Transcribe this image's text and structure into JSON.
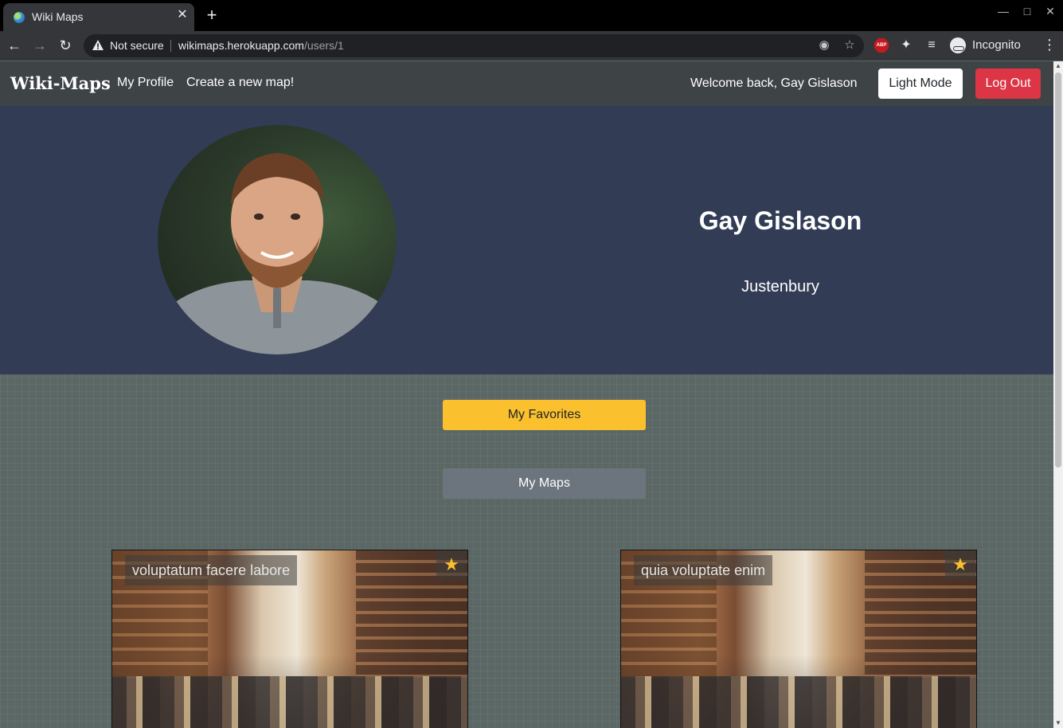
{
  "browser": {
    "tab_title": "Wiki Maps",
    "tab_close": "✕",
    "new_tab": "+",
    "security_label": "Not secure",
    "url_host": "wikimaps.herokuapp.com",
    "url_path": "/users/1",
    "incognito_label": "Incognito",
    "abp_label": "ABP"
  },
  "navbar": {
    "brand": "Wiki-Maps",
    "links": [
      "My Profile",
      "Create a new map!"
    ],
    "welcome": "Welcome back, Gay Gislason",
    "light_mode": "Light Mode",
    "logout": "Log Out"
  },
  "profile": {
    "name": "Gay Gislason",
    "city": "Justenbury"
  },
  "buttons": {
    "favorites": "My Favorites",
    "my_maps": "My Maps"
  },
  "maps": [
    {
      "title": "voluptatum facere labore"
    },
    {
      "title": "quia voluptate enim"
    }
  ],
  "colors": {
    "navbar": "#3e4346",
    "hero": "#323c55",
    "page": "#5b6764",
    "favorites": "#fbc02d",
    "logout": "#dc3545",
    "maps_button": "#6c757d"
  }
}
